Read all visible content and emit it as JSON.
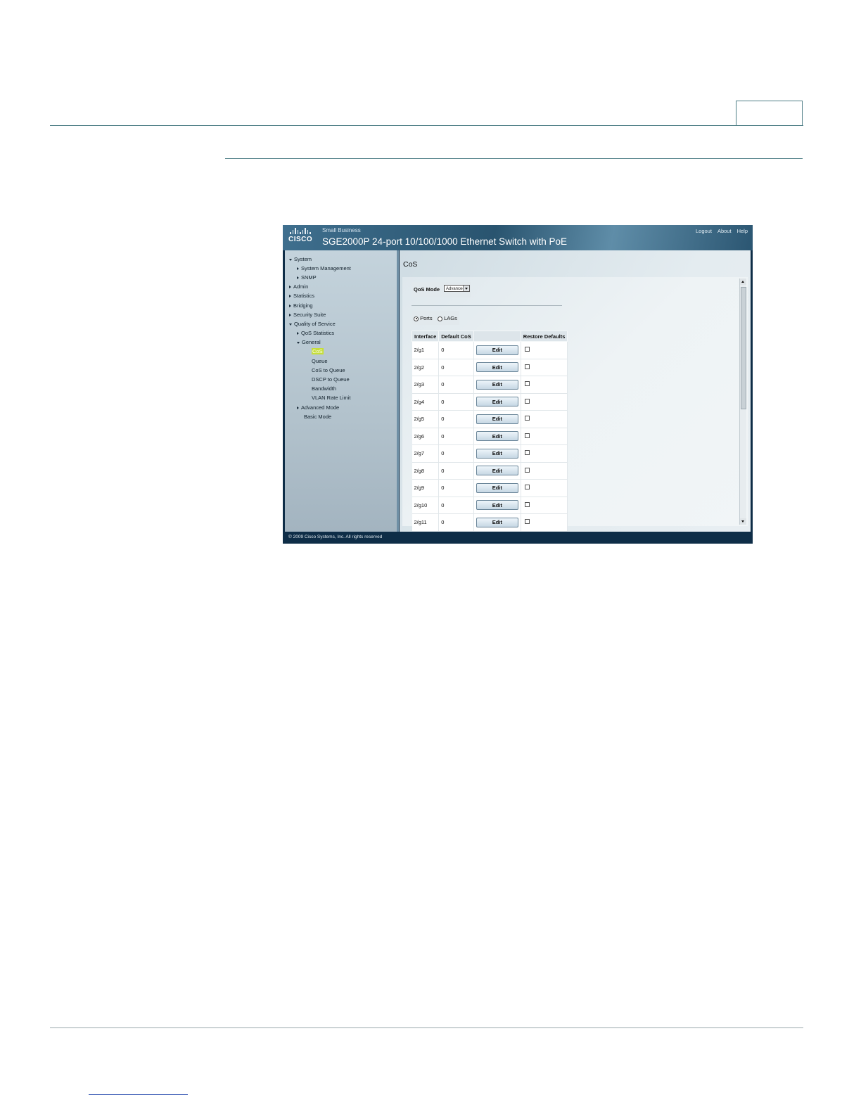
{
  "app": {
    "brand": "CISCO",
    "subtitle": "Small Business",
    "product_title": "SGE2000P 24-port 10/100/1000 Ethernet Switch with PoE",
    "top_links": [
      "Logout",
      "About",
      "Help"
    ],
    "footer": "© 2009 Cisco Systems, Inc. All rights reserved"
  },
  "nav": {
    "items": [
      {
        "label": "System",
        "state": "expanded"
      },
      {
        "label": "System Management",
        "state": "collapsed"
      },
      {
        "label": "SNMP",
        "state": "collapsed"
      },
      {
        "label": "Admin",
        "state": "collapsed"
      },
      {
        "label": "Statistics",
        "state": "collapsed"
      },
      {
        "label": "Bridging",
        "state": "collapsed"
      },
      {
        "label": "Security Suite",
        "state": "collapsed"
      },
      {
        "label": "Quality of Service",
        "state": "expanded"
      },
      {
        "label": "QoS Statistics",
        "state": "collapsed"
      },
      {
        "label": "General",
        "state": "expanded"
      },
      {
        "label": "CoS",
        "state": "selected"
      },
      {
        "label": "Queue",
        "state": "leaf"
      },
      {
        "label": "CoS to Queue",
        "state": "leaf"
      },
      {
        "label": "DSCP to Queue",
        "state": "leaf"
      },
      {
        "label": "Bandwidth",
        "state": "leaf"
      },
      {
        "label": "VLAN Rate Limit",
        "state": "leaf"
      },
      {
        "label": "Advanced Mode",
        "state": "collapsed"
      },
      {
        "label": "Basic Mode",
        "state": "leaf"
      }
    ]
  },
  "content": {
    "page_title": "CoS",
    "qos_mode_label": "QoS Mode",
    "qos_mode_value": "Advanced",
    "radio_ports": "Ports",
    "radio_lags": "LAGs",
    "selected_radio": "Ports",
    "table": {
      "headers": [
        "Interface",
        "Default CoS",
        "",
        "Restore Defaults"
      ],
      "edit_label": "Edit",
      "rows": [
        {
          "interface": "2/g1",
          "default_cos": "0"
        },
        {
          "interface": "2/g2",
          "default_cos": "0"
        },
        {
          "interface": "2/g3",
          "default_cos": "0"
        },
        {
          "interface": "2/g4",
          "default_cos": "0"
        },
        {
          "interface": "2/g5",
          "default_cos": "0"
        },
        {
          "interface": "2/g6",
          "default_cos": "0"
        },
        {
          "interface": "2/g7",
          "default_cos": "0"
        },
        {
          "interface": "2/g8",
          "default_cos": "0"
        },
        {
          "interface": "2/g9",
          "default_cos": "0"
        },
        {
          "interface": "2/g10",
          "default_cos": "0"
        },
        {
          "interface": "2/g11",
          "default_cos": "0"
        }
      ]
    }
  }
}
